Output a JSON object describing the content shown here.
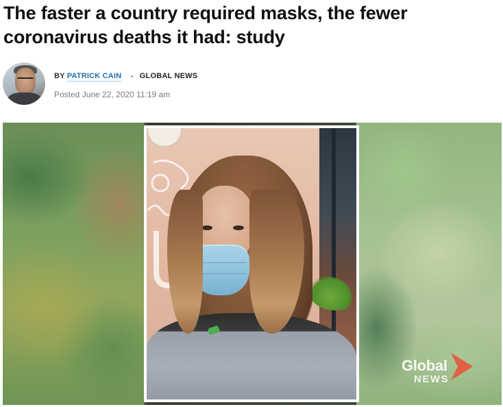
{
  "article": {
    "headline": "The faster a country required masks, the fewer coronavirus deaths it had: study",
    "byline": {
      "by_label": "BY",
      "author": "PATRICK CAIN",
      "separator": "-",
      "outlet": "GLOBAL NEWS"
    },
    "posted": "Posted June 22, 2020 11:19 am"
  },
  "media": {
    "watermark": {
      "word1": "Global",
      "word2": "NEWS",
      "chevron_color": "#e8553b"
    }
  },
  "colors": {
    "author_link": "#1f6fb2",
    "headline": "#111111",
    "meta": "#7a7a7a"
  },
  "icons": {
    "author_avatar": "author-avatar"
  }
}
